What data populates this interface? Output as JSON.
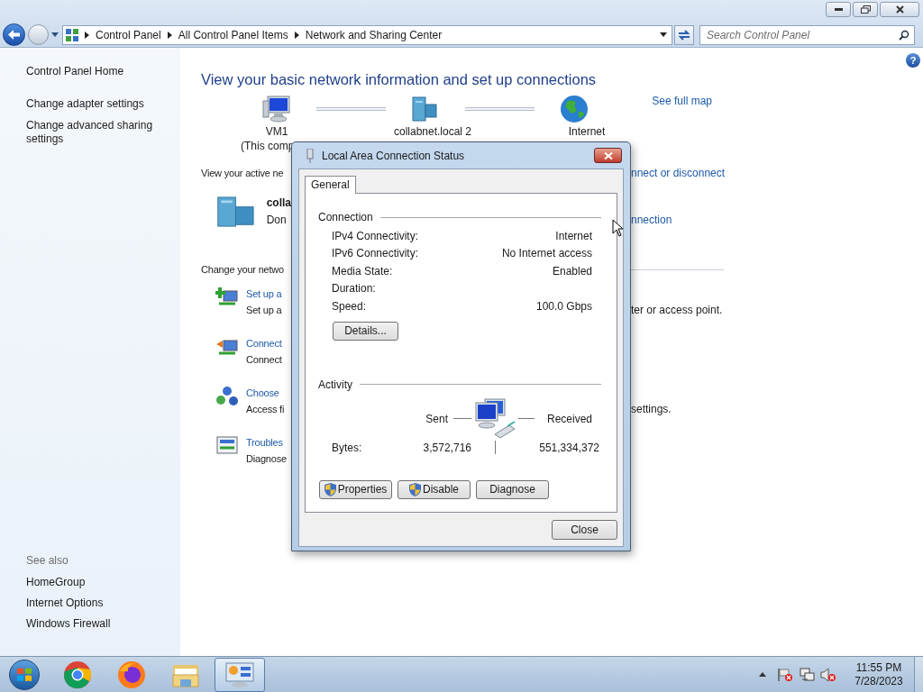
{
  "address_bar": {
    "breadcrumbs": [
      "Control Panel",
      "All Control Panel Items",
      "Network and Sharing Center"
    ]
  },
  "search": {
    "placeholder": "Search Control Panel"
  },
  "help": {
    "label": "?"
  },
  "sidebar": {
    "links": [
      "Control Panel Home",
      "Change adapter settings",
      "Change advanced sharing settings"
    ],
    "see_also_heading": "See also",
    "see_also": [
      "HomeGroup",
      "Internet Options",
      "Windows Firewall"
    ]
  },
  "main": {
    "heading": "View your basic network information and set up connections",
    "see_full_map": "See full map",
    "map_nodes": [
      {
        "kind": "computer",
        "label": "VM1",
        "sublabel": "(This comp"
      },
      {
        "kind": "network",
        "label": "collabnet.local 2"
      },
      {
        "kind": "globe",
        "label": "Internet"
      }
    ],
    "active_networks_label": "View your active ne",
    "connect_link": "nnect or disconnect",
    "network": {
      "name": "colla",
      "type": "Don",
      "connection_link": "nnection"
    },
    "change_label": "Change your netwo",
    "tasks": [
      {
        "kind": "setup",
        "title": "Set up a",
        "description": "Set up a",
        "description_tail": "ter or access point."
      },
      {
        "kind": "connect",
        "title": "Connect",
        "description": "Connect"
      },
      {
        "kind": "homegroup",
        "title": "Choose",
        "description": "Access fi",
        "description_tail": "settings."
      },
      {
        "kind": "troubleshoot",
        "title": "Troubles",
        "description": "Diagnose"
      }
    ]
  },
  "dialog": {
    "title": "Local Area Connection Status",
    "tabs": [
      {
        "label": "General",
        "selected": true
      }
    ],
    "connection": {
      "heading": "Connection",
      "rows": [
        {
          "label": "IPv4 Connectivity:",
          "value": "Internet"
        },
        {
          "label": "IPv6 Connectivity:",
          "value": "No Internet access"
        },
        {
          "label": "Media State:",
          "value": "Enabled"
        },
        {
          "label": "Duration:"
        },
        {
          "label": "Speed:",
          "value": "100.0 Gbps"
        }
      ],
      "details_button": "Details..."
    },
    "activity": {
      "heading": "Activity",
      "sent_label": "Sent",
      "received_label": "Received",
      "bytes_label": "Bytes:",
      "sent": "3,572,716",
      "received": "551,334,372"
    },
    "buttons": [
      {
        "label": "Properties",
        "shield": true
      },
      {
        "label": "Disable",
        "shield": true
      },
      {
        "label": "Diagnose",
        "shield": false
      }
    ],
    "close_button": "Close"
  },
  "taskbar": {
    "apps": [
      {
        "kind": "chrome",
        "selected": false
      },
      {
        "kind": "firefox",
        "selected": false
      },
      {
        "kind": "explorer",
        "selected": false
      },
      {
        "kind": "control_panel",
        "selected": true
      }
    ],
    "clock": {
      "time": "11:55 PM",
      "date": "7/28/2023"
    }
  }
}
